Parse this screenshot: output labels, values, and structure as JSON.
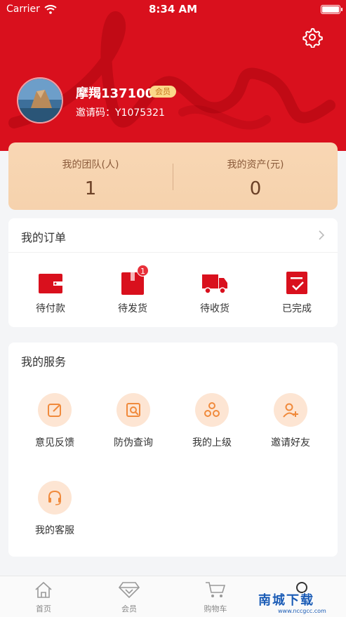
{
  "status_bar": {
    "carrier": "Carrier",
    "time": "8:34 AM"
  },
  "profile": {
    "username": "摩羯137100",
    "member_badge": "会员",
    "invite_code": "邀请码：Y1075321"
  },
  "assets": {
    "team_label": "我的团队(人)",
    "team_value": "1",
    "asset_label": "我的资产(元)",
    "asset_value": "0"
  },
  "orders": {
    "title": "我的订单",
    "items": [
      {
        "label": "待付款",
        "icon": "wallet-icon"
      },
      {
        "label": "待发货",
        "icon": "package-icon",
        "badge": "1"
      },
      {
        "label": "待收货",
        "icon": "truck-icon"
      },
      {
        "label": "已完成",
        "icon": "checklist-icon"
      }
    ]
  },
  "services": {
    "title": "我的服务",
    "items": [
      {
        "label": "意见反馈",
        "icon": "feedback-icon"
      },
      {
        "label": "防伪查询",
        "icon": "anti-fake-search-icon"
      },
      {
        "label": "我的上级",
        "icon": "hierarchy-icon"
      },
      {
        "label": "邀请好友",
        "icon": "add-user-icon"
      },
      {
        "label": "我的客服",
        "icon": "headset-icon"
      }
    ]
  },
  "tabbar": {
    "items": [
      {
        "label": "首页",
        "icon": "home-icon"
      },
      {
        "label": "会员",
        "icon": "diamond-icon"
      },
      {
        "label": "购物车",
        "icon": "cart-icon"
      },
      {
        "label": "",
        "icon": "profile-icon"
      }
    ]
  },
  "watermark": {
    "main": "南城下载",
    "url": "www.nccgcc.com"
  },
  "colors": {
    "brand_red": "#d9101d",
    "accent_orange": "#f08a3c",
    "asset_card": "#f8d7b4"
  }
}
